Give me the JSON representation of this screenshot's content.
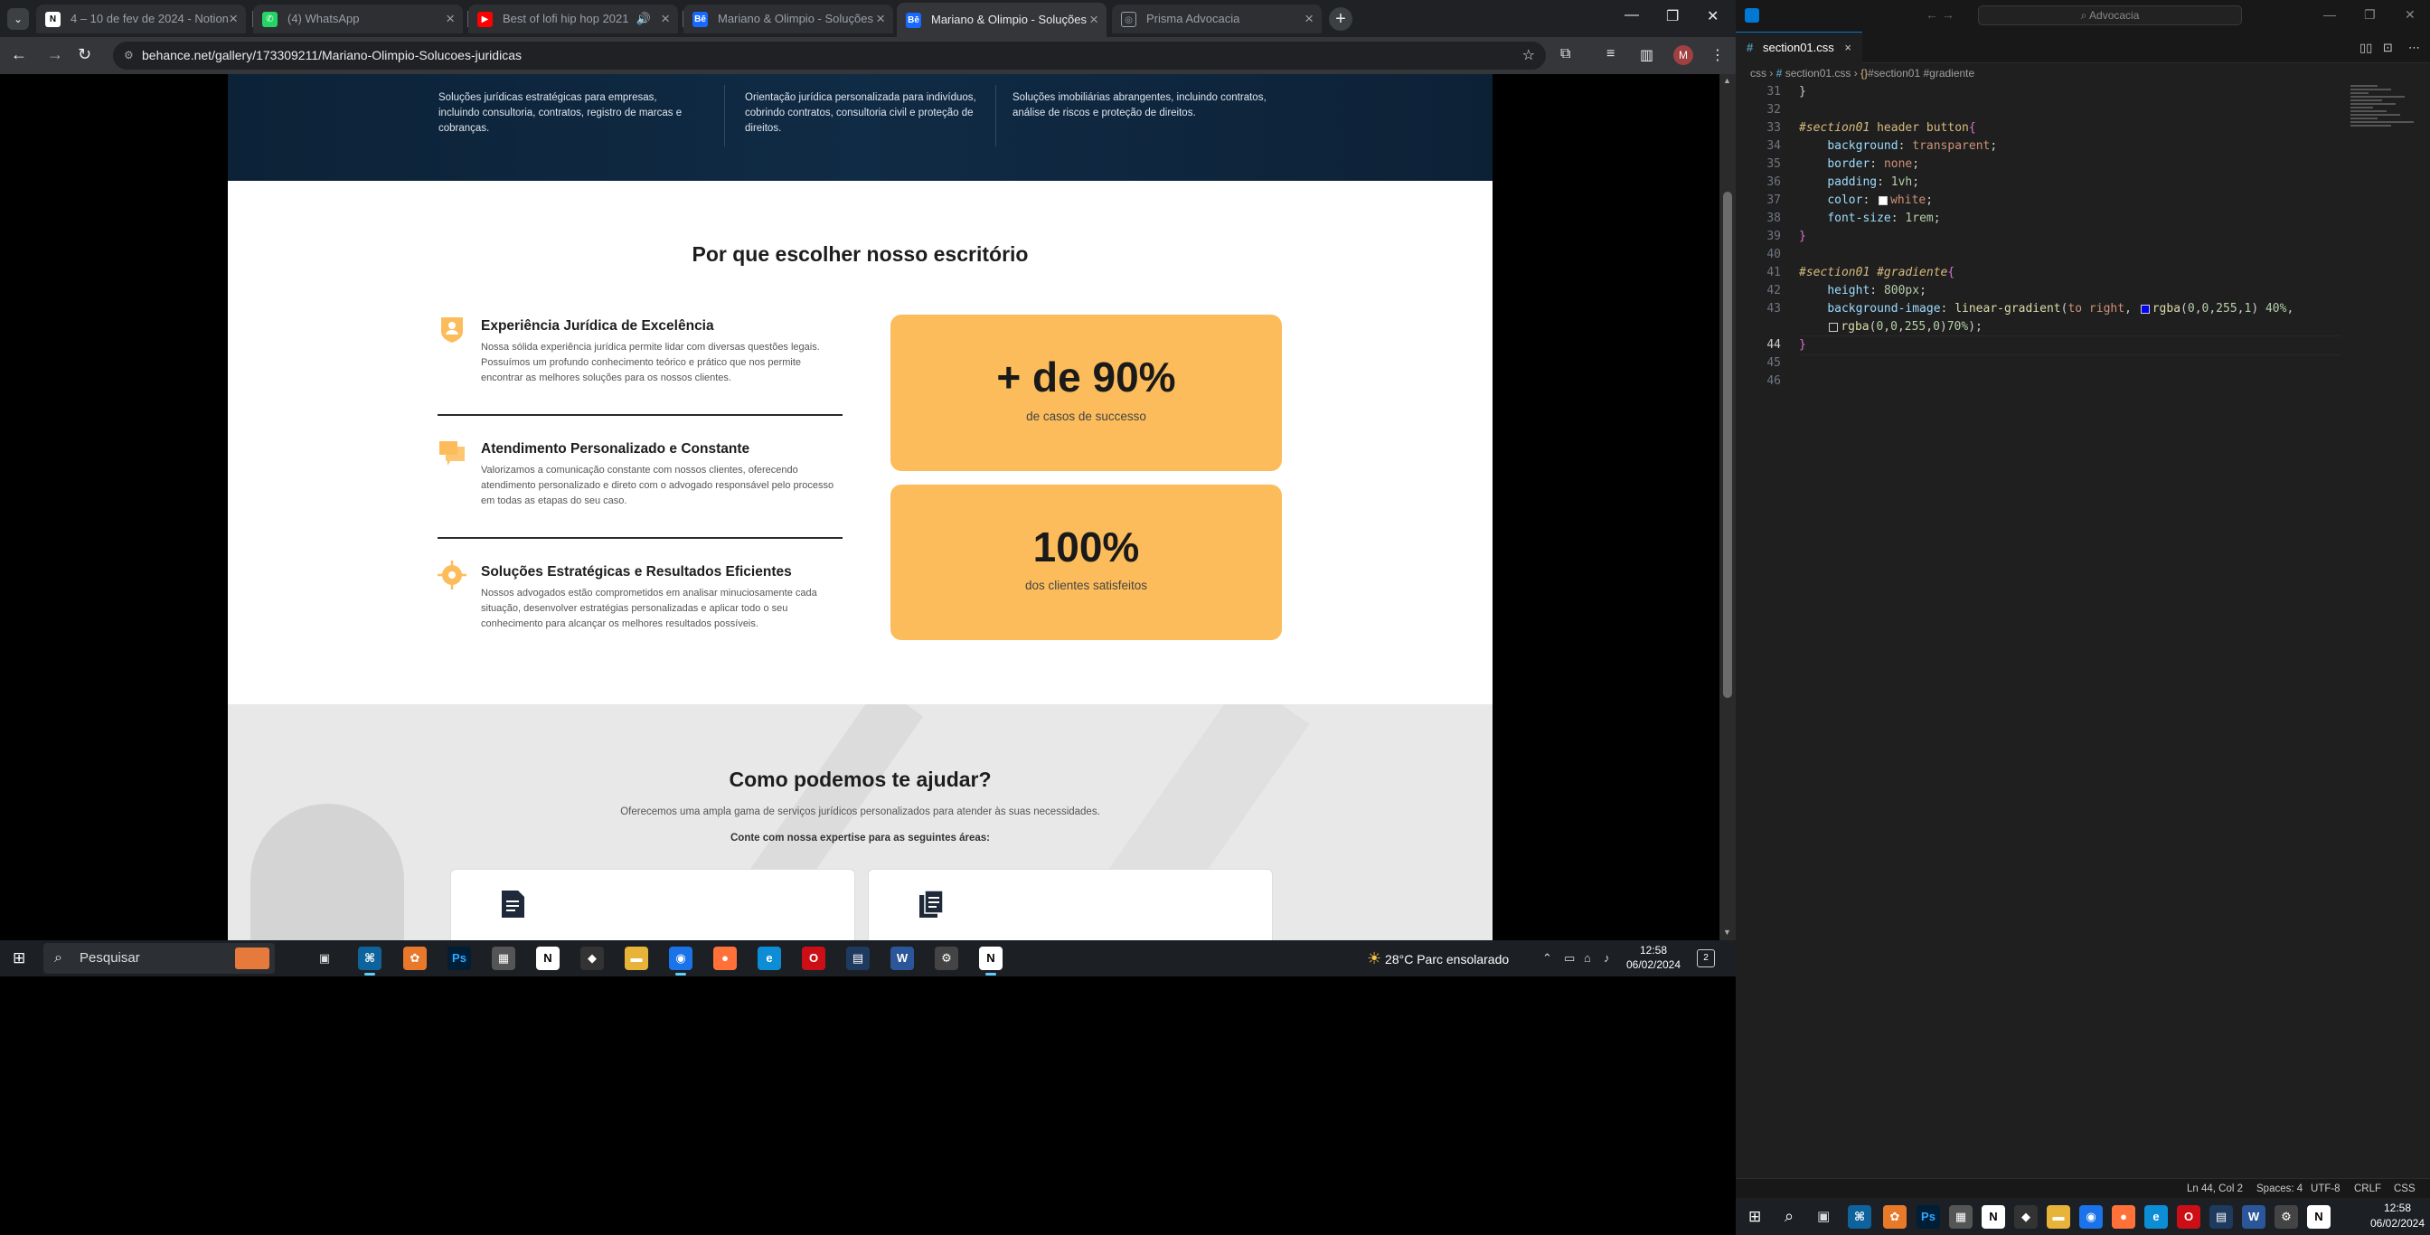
{
  "browser": {
    "tabs": [
      {
        "label": "4 – 10 de fev de 2024 - Notion",
        "icon": "notion-icon"
      },
      {
        "label": "(4) WhatsApp",
        "icon": "whatsapp-icon"
      },
      {
        "label": "Best of lofi hip hop 2021",
        "icon": "youtube-icon"
      },
      {
        "label": "Mariano & Olimpio - Soluções",
        "icon": "behance-icon"
      },
      {
        "label": "Mariano & Olimpio - Soluções",
        "icon": "behance-icon"
      },
      {
        "label": "Prisma Advocacia",
        "icon": "globe-icon"
      }
    ],
    "url": "behance.net/gallery/173309211/Mariano-Olimpio-Solucoes-juridicas",
    "profile_initial": "M"
  },
  "page": {
    "hero_cols": [
      "Soluções jurídicas estratégicas para empresas, incluindo consultoria, contratos, registro de marcas e cobranças.",
      "Orientação jurídica personalizada para indivíduos, cobrindo contratos, consultoria civil e proteção de direitos.",
      "Soluções imobiliárias abrangentes, incluindo contratos, análise de riscos e proteção de direitos."
    ],
    "why_title": "Por que escolher nosso escritório",
    "features": [
      {
        "title": "Experiência Jurídica de Excelência",
        "text": "Nossa sólida experiência jurídica permite lidar com diversas questões legais. Possuímos um profundo conhecimento teórico e prático que nos permite encontrar as melhores soluções para os nossos clientes."
      },
      {
        "title": "Atendimento Personalizado e Constante",
        "text": "Valorizamos a comunicação constante com nossos clientes, oferecendo atendimento personalizado e direto com o advogado responsável pelo processo em todas as etapas do seu caso."
      },
      {
        "title": "Soluções Estratégicas e Resultados Eficientes",
        "text": "Nossos advogados estão comprometidos em analisar minuciosamente cada situação, desenvolver estratégias personalizadas e aplicar todo o seu conhecimento para alcançar os melhores resultados possíveis."
      }
    ],
    "stats": [
      {
        "value": "+ de 90%",
        "label": "de casos de successo"
      },
      {
        "value": "100%",
        "label": "dos clientes satisfeitos"
      }
    ],
    "help_title": "Como podemos te ajudar?",
    "help_sub": "Oferecemos uma ampla gama de serviços jurídicos personalizados para atender às suas necessidades.",
    "help_sub2": "Conte com nossa expertise para as seguintes áreas:",
    "accent": "#fcbc5b",
    "hero_color": "#0f2840"
  },
  "taskbar": {
    "search_placeholder": "Pesquisar",
    "weather": "28°C  Parc ensolarado",
    "time": "12:58",
    "date": "06/02/2024",
    "notif_count": "2"
  },
  "vscode": {
    "search": "Advocacia",
    "tab": "section01.css",
    "breadcrumb": [
      "css",
      "section01.css",
      "#section01 #gradiente"
    ],
    "lines": [
      {
        "n": "31",
        "html": "<span>}</span>"
      },
      {
        "n": "32",
        "html": ""
      },
      {
        "n": "33",
        "html": "<span class='sel'>#section01</span> <span class='tag'>header button</span><span class='br'>{</span>"
      },
      {
        "n": "34",
        "html": "    <span class='prop'>background</span>: <span class='kw'>transparent</span>;"
      },
      {
        "n": "35",
        "html": "    <span class='prop'>border</span>: <span class='kw'>none</span>;"
      },
      {
        "n": "36",
        "html": "    <span class='prop'>padding</span>: <span class='num'>1vh</span>;"
      },
      {
        "n": "37",
        "html": "    <span class='prop'>color</span>: <i class='sw' style='background:#fff'></i><span class='kw'>white</span>;"
      },
      {
        "n": "38",
        "html": "    <span class='prop'>font-size</span>: <span class='num'>1rem</span>;"
      },
      {
        "n": "39",
        "html": "<span class='br'>}</span>"
      },
      {
        "n": "40",
        "html": ""
      },
      {
        "n": "41",
        "html": "<span class='sel'>#section01 #gradiente</span><span class='br'>{</span>"
      },
      {
        "n": "42",
        "html": "    <span class='prop'>height</span>: <span class='num'>800px</span>;"
      },
      {
        "n": "43",
        "html": "    <span class='prop'>background-image</span>: <span class='fn'>linear-gradient</span>(<span class='kw'>to right</span>, <i class='sw' style='background:#0000ff'></i><span class='fn'>rgba</span>(<span class='num'>0</span>,<span class='num'>0</span>,<span class='num'>255</span>,<span class='num'>1</span>) <span class='num'>40%</span>,"
      },
      {
        "n": "",
        "html": "    <i class='sw' style='background:transparent'></i><span class='fn'>rgba</span>(<span class='num'>0</span>,<span class='num'>0</span>,<span class='num'>255</span>,<span class='num'>0</span>)<span class='num'>70%</span>);"
      },
      {
        "n": "44",
        "html": "<span class='br'>}</span>",
        "cur": true
      },
      {
        "n": "45",
        "html": ""
      },
      {
        "n": "46",
        "html": ""
      }
    ],
    "status": {
      "pos": "Ln 44, Col 2",
      "spaces": "Spaces: 4",
      "enc": "UTF-8",
      "eol": "CRLF",
      "lang": "CSS"
    },
    "time": "12:58",
    "date": "06/02/2024"
  }
}
